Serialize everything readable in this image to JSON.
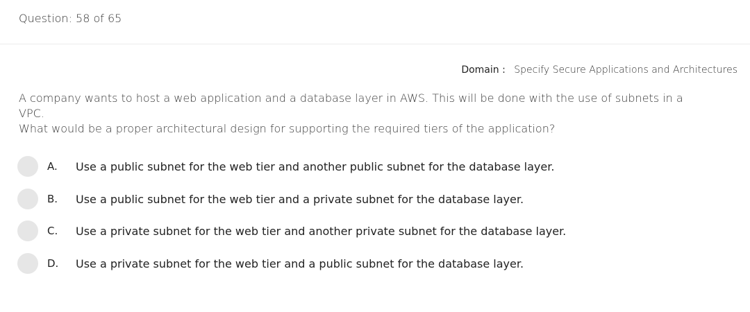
{
  "header": {
    "question_counter": "Question: 58 of 65"
  },
  "domain": {
    "label": "Domain :",
    "value": "Specify Secure Applications and Architectures"
  },
  "question": {
    "text_line1": "A company wants to host a web application and a database layer in AWS. This will be done with the use of subnets in a VPC.",
    "text_line2": "What would be a proper architectural design for supporting the required tiers of the application?"
  },
  "options": [
    {
      "letter": "A.",
      "text": "Use a public subnet for the web tier and another public subnet for the database layer."
    },
    {
      "letter": "B.",
      "text": "Use a public subnet for the web tier and a private subnet for the database layer."
    },
    {
      "letter": "C.",
      "text": "Use a private subnet for the web tier and another private subnet for the database layer."
    },
    {
      "letter": "D.",
      "text": "Use a private subnet for the web tier and a public subnet for the database layer."
    }
  ]
}
